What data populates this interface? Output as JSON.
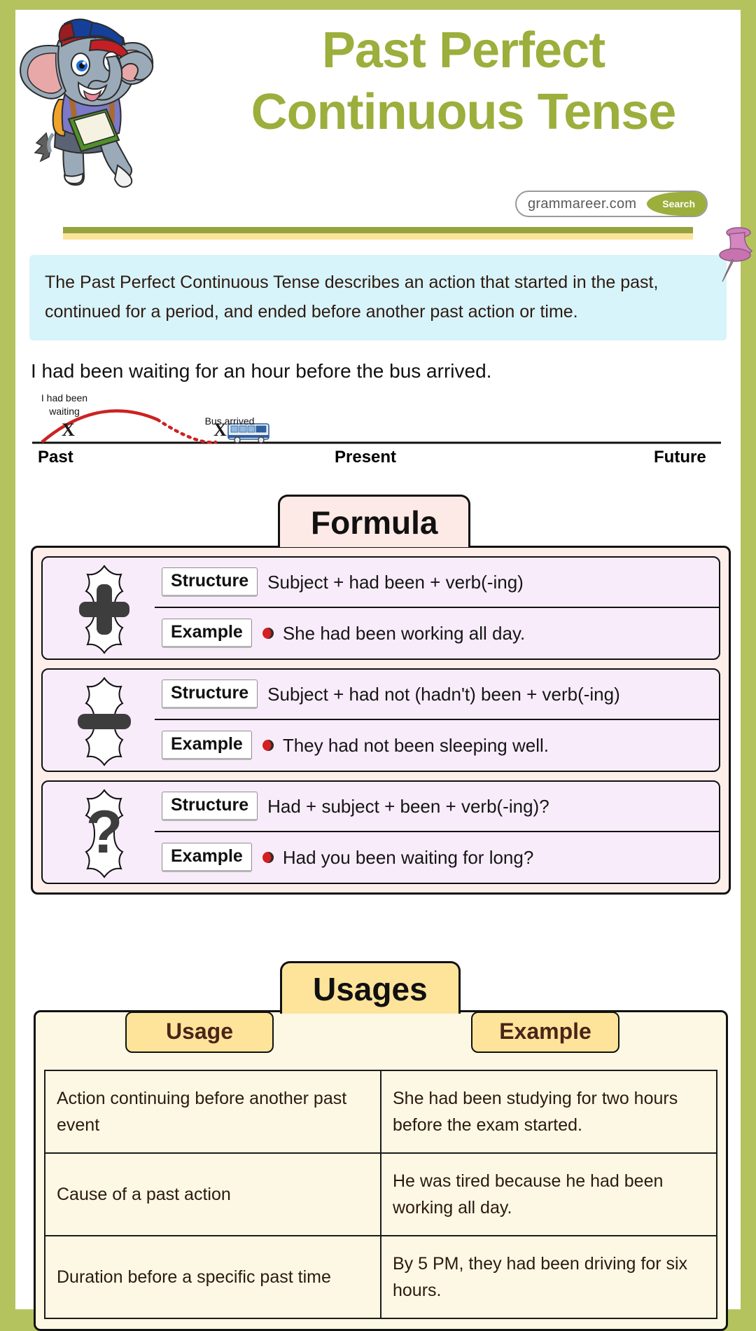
{
  "theme": {
    "border_green": "#b5c35e",
    "title_green": "#9cae3c",
    "definition_blue": "#d7f4fb",
    "formula_pink": "#fdeeea",
    "formula_row_purple": "#f8ecfb",
    "usages_yellow": "#fde49a",
    "usages_cream": "#fdf8e4",
    "pushpin_pink": "#d983c0",
    "bullet_red": "#d42020"
  },
  "header": {
    "title_line1": "Past Perfect",
    "title_line2": "Continuous Tense",
    "mascot_alt": "elephant-mascot",
    "search": {
      "url": "grammareer.com",
      "button_label": "Search"
    }
  },
  "definition": {
    "text": "The Past Perfect Continuous Tense describes an action that started in the past, continued for a period, and ended before another past action or time."
  },
  "example_sentence": {
    "text": "I had been waiting for an hour before the bus arrived."
  },
  "timeline": {
    "start_label_line1": "I had been",
    "start_label_line2": "waiting",
    "event_label": "Bus arrived",
    "marker": "X",
    "axis": {
      "past": "Past",
      "present": "Present",
      "future": "Future"
    }
  },
  "formula": {
    "heading": "Formula",
    "structure_label": "Structure",
    "example_label": "Example",
    "rows": [
      {
        "sign": "plus",
        "sign_glyph": "+",
        "structure": "Subject + had been + verb(-ing)",
        "example": "She had been working all day."
      },
      {
        "sign": "minus",
        "sign_glyph": "−",
        "structure": "Subject + had not (hadn't) been + verb(-ing)",
        "example": "They had not been sleeping well."
      },
      {
        "sign": "question",
        "sign_glyph": "?",
        "structure": "Had + subject + been + verb(-ing)?",
        "example": "Had you been waiting for long?"
      }
    ]
  },
  "usages": {
    "heading": "Usages",
    "columns": {
      "usage": "Usage",
      "example": "Example"
    },
    "rows": [
      {
        "usage": "Action continuing before another past event",
        "example": "She had been studying for two hours before the exam started."
      },
      {
        "usage": "Cause of a past action",
        "example": "He was tired because he had been working all day."
      },
      {
        "usage": "Duration before a specific past time",
        "example": "By 5 PM, they had been driving for six hours."
      }
    ]
  }
}
